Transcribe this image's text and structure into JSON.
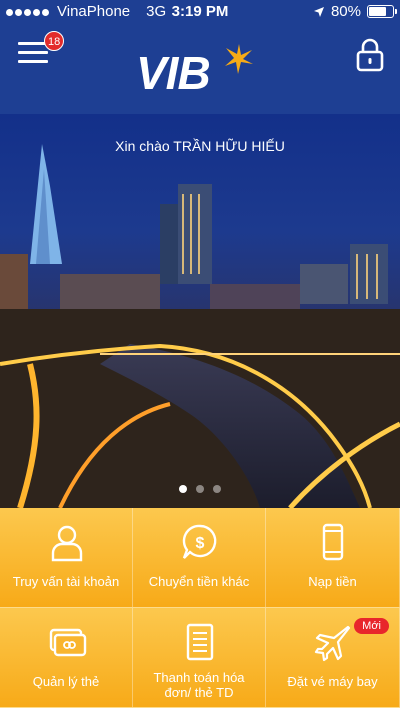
{
  "status_bar": {
    "carrier": "VinaPhone",
    "network": "3G",
    "time": "3:19 PM",
    "battery": "80%",
    "battery_level": 0.8
  },
  "header": {
    "notification_count": "18",
    "logo_text": "VIB",
    "menu_icon": "hamburger-icon",
    "lock_icon": "lock-icon"
  },
  "hero": {
    "greeting": "Xin chào TRẦN HỮU HIẾU",
    "slide_count": 3,
    "active_slide": 1
  },
  "tiles": [
    {
      "label": "Truy vấn tài khoản",
      "icon": "user-icon"
    },
    {
      "label": "Chuyển tiền khác",
      "icon": "money-chat-icon"
    },
    {
      "label": "Nạp tiền",
      "icon": "phone-icon"
    },
    {
      "label": "Quản lý thẻ",
      "icon": "card-icon"
    },
    {
      "label": "Thanh toán hóa đơn/ thẻ TD",
      "icon": "bill-icon"
    },
    {
      "label": "Đặt vé máy bay",
      "icon": "airplane-icon",
      "badge": "Mới"
    }
  ],
  "colors": {
    "brand_blue": "#1e3f93",
    "tile_orange": "#f7aa18",
    "badge_red": "#e32b2b"
  }
}
